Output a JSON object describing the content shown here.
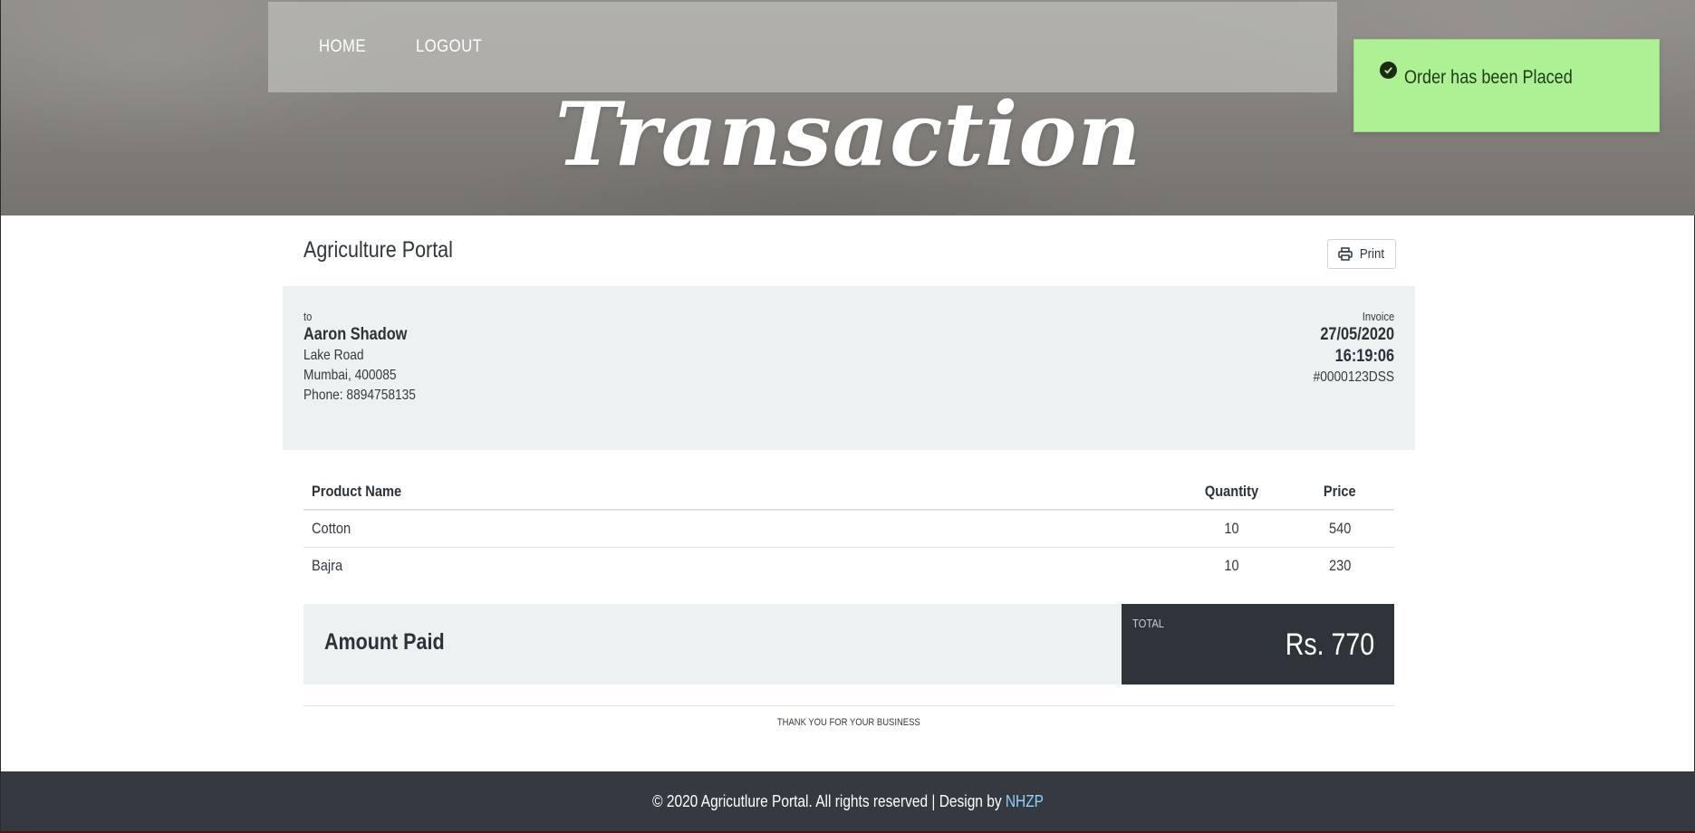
{
  "nav": {
    "home": "HOME",
    "logout": "LOGOUT"
  },
  "hero": {
    "title": "Transaction"
  },
  "toast": {
    "message": "Order has been Placed",
    "icon": "check-circle-icon",
    "color": "#aef195"
  },
  "invoice": {
    "brand": "Agriculture Portal",
    "print_label": "Print",
    "to": {
      "caption": "to",
      "name": "Aaron Shadow",
      "address1": "Lake Road",
      "address2": "Mumbai, 400085",
      "phone": "Phone: 8894758135"
    },
    "meta": {
      "caption": "Invoice",
      "date": "27/05/2020",
      "time": "16:19:06",
      "number": "#0000123DSS"
    },
    "table": {
      "headers": {
        "product": "Product Name",
        "quantity": "Quantity",
        "price": "Price"
      },
      "rows": [
        {
          "product": "Cotton",
          "quantity": "10",
          "price": "540"
        },
        {
          "product": "Bajra",
          "quantity": "10",
          "price": "230"
        }
      ]
    },
    "amount": {
      "label": "Amount Paid",
      "total_caption": "TOTAL",
      "total_value": "Rs. 770"
    },
    "thanks": "THANK YOU FOR YOUR BUSINESS"
  },
  "footer": {
    "text": "© 2020 Agricutlure Portal. All rights reserved | Design by ",
    "link": "NHZP"
  },
  "colors": {
    "dark": "#343a40",
    "panel": "#eef1f1",
    "link": "#8fd3ff"
  }
}
